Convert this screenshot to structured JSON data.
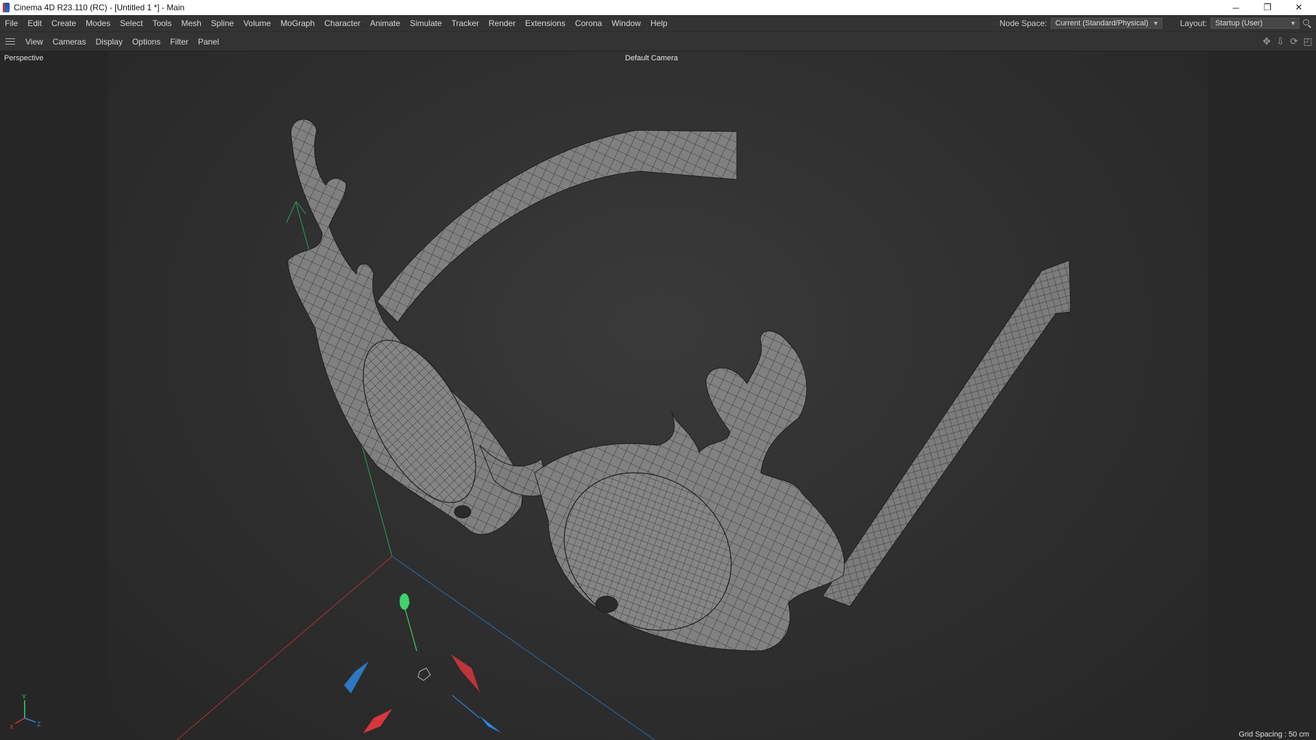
{
  "window": {
    "title": "Cinema 4D R23.110 (RC) - [Untitled 1 *] - Main",
    "controls": {
      "minimize": "─",
      "restore": "❐",
      "close": "✕"
    }
  },
  "menubar": {
    "items": [
      "File",
      "Edit",
      "Create",
      "Modes",
      "Select",
      "Tools",
      "Mesh",
      "Spline",
      "Volume",
      "MoGraph",
      "Character",
      "Animate",
      "Simulate",
      "Tracker",
      "Render",
      "Extensions",
      "Corona",
      "Window",
      "Help"
    ],
    "node_space_label": "Node Space:",
    "node_space_value": "Current (Standard/Physical)",
    "layout_label": "Layout:",
    "layout_value": "Startup (User)"
  },
  "viewport_menu": {
    "items": [
      "View",
      "Cameras",
      "Display",
      "Options",
      "Filter",
      "Panel"
    ],
    "icons": [
      "move-view-icon",
      "dolly-view-icon",
      "rotate-view-icon",
      "maximize-view-icon"
    ]
  },
  "viewport": {
    "projection": "Perspective",
    "camera": "Default Camera",
    "grid_spacing": "Grid Spacing : 50 cm",
    "axis_labels": {
      "x": "X",
      "y": "Y",
      "z": "Z"
    }
  },
  "colors": {
    "axis_x": "#d9363e",
    "axis_y": "#3fd46a",
    "axis_z": "#2e86de",
    "mesh_fill": "#7f7f7f",
    "mesh_wire": "#1c1c1c"
  }
}
